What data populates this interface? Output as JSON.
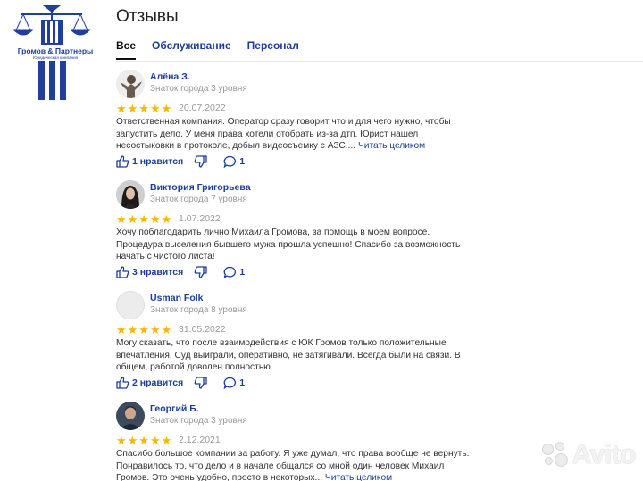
{
  "logo": {
    "name": "Громов & Партнеры",
    "subtitle": "Юридическая компания"
  },
  "page_title": "Отзывы",
  "tabs": [
    {
      "label": "Все",
      "active": true
    },
    {
      "label": "Обслуживание",
      "active": false
    },
    {
      "label": "Персонал",
      "active": false
    }
  ],
  "reviews": [
    {
      "name": "Алёна З.",
      "level": "Знаток города 3 уровня",
      "rating": 5,
      "stars": "★★★★★",
      "date": "20.07.2022",
      "text": "Ответственная компания. Оператор сразу говорит что и для чего нужно, чтобы запустить дело. У меня права хотели отобрать из-за дтп. Юрист нашел несостыковки в протоколе, добыл видеосъемку с АЗС....",
      "more": "Читать целиком",
      "likes": "1 нравится",
      "comments": "1"
    },
    {
      "name": "Виктория Григорьева",
      "level": "Знаток города 7 уровня",
      "rating": 5,
      "stars": "★★★★★",
      "date": "1.07.2022",
      "text": "Хочу поблагодарить лично Михаила Громова, за помощь в моем вопросе. Процедура выселения бывшего мужа прошла успешно! Спасибо за возможность начать с чистого листа!",
      "more": "",
      "likes": "3 нравится",
      "comments": "1"
    },
    {
      "name": "Usman Folk",
      "level": "Знаток города 8 уровня",
      "rating": 5,
      "stars": "★★★★★",
      "date": "31.05.2022",
      "text": "Могу сказать, что после взаимодействия с ЮК Громов только положительные впечатления. Суд выиграли, оперативно, не затягивали. Всегда были на связи. В общем, работой доволен полностью.",
      "more": "",
      "likes": "2 нравится",
      "comments": "1"
    },
    {
      "name": "Георгий Б.",
      "level": "Знаток города 3 уровня",
      "rating": 5,
      "stars": "★★★★★",
      "date": "2.12.2021",
      "text": "Спасибо большое компании за работу. Я уже думал, что права вообще не вернуть. Понравилось то, что дело и в начале общался со мной один человек Михаил Громов. Это очень удобно, просто в некоторых...",
      "more": "Читать целиком",
      "likes": "",
      "comments": ""
    }
  ],
  "watermark": "Avito",
  "colors": {
    "link": "#1d3d96",
    "star": "#f5b800",
    "muted": "#999999",
    "logo": "#1f3f9a"
  }
}
